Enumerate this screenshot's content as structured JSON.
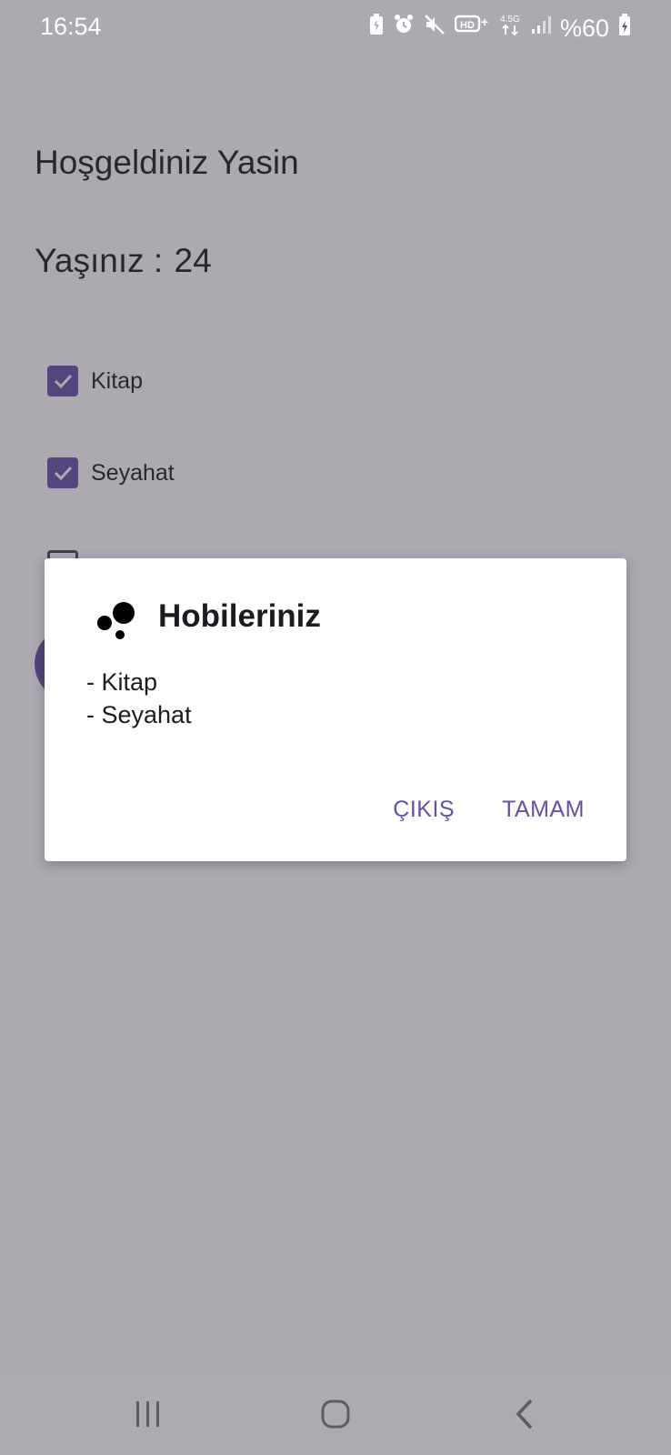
{
  "status_bar": {
    "time": "16:54",
    "battery": "%60",
    "network": "4.5G",
    "icons": [
      "battery-saver-icon",
      "alarm-icon",
      "mute-icon",
      "hd-plus-icon",
      "network-4-5g-icon",
      "signal-icon",
      "battery-icon"
    ]
  },
  "screen": {
    "greeting": "Hoşgeldiniz Yasin",
    "age_label": "Yaşınız :",
    "age_value": "24",
    "hobbies": [
      {
        "label": "Kitap",
        "checked": true
      },
      {
        "label": "Seyahat",
        "checked": true
      },
      {
        "label": "",
        "checked": false
      }
    ]
  },
  "dialog": {
    "icon": "dots-icon",
    "title": "Hobileriniz",
    "message_lines": [
      "- Kitap",
      "- Seyahat"
    ],
    "negative_button": "ÇIKIŞ",
    "positive_button": "TAMAM"
  },
  "nav_bar": {
    "icons": [
      "recent-apps-icon",
      "home-icon",
      "back-icon"
    ]
  },
  "colors": {
    "accent": "#6750a4",
    "text": "#1c1b1f"
  }
}
